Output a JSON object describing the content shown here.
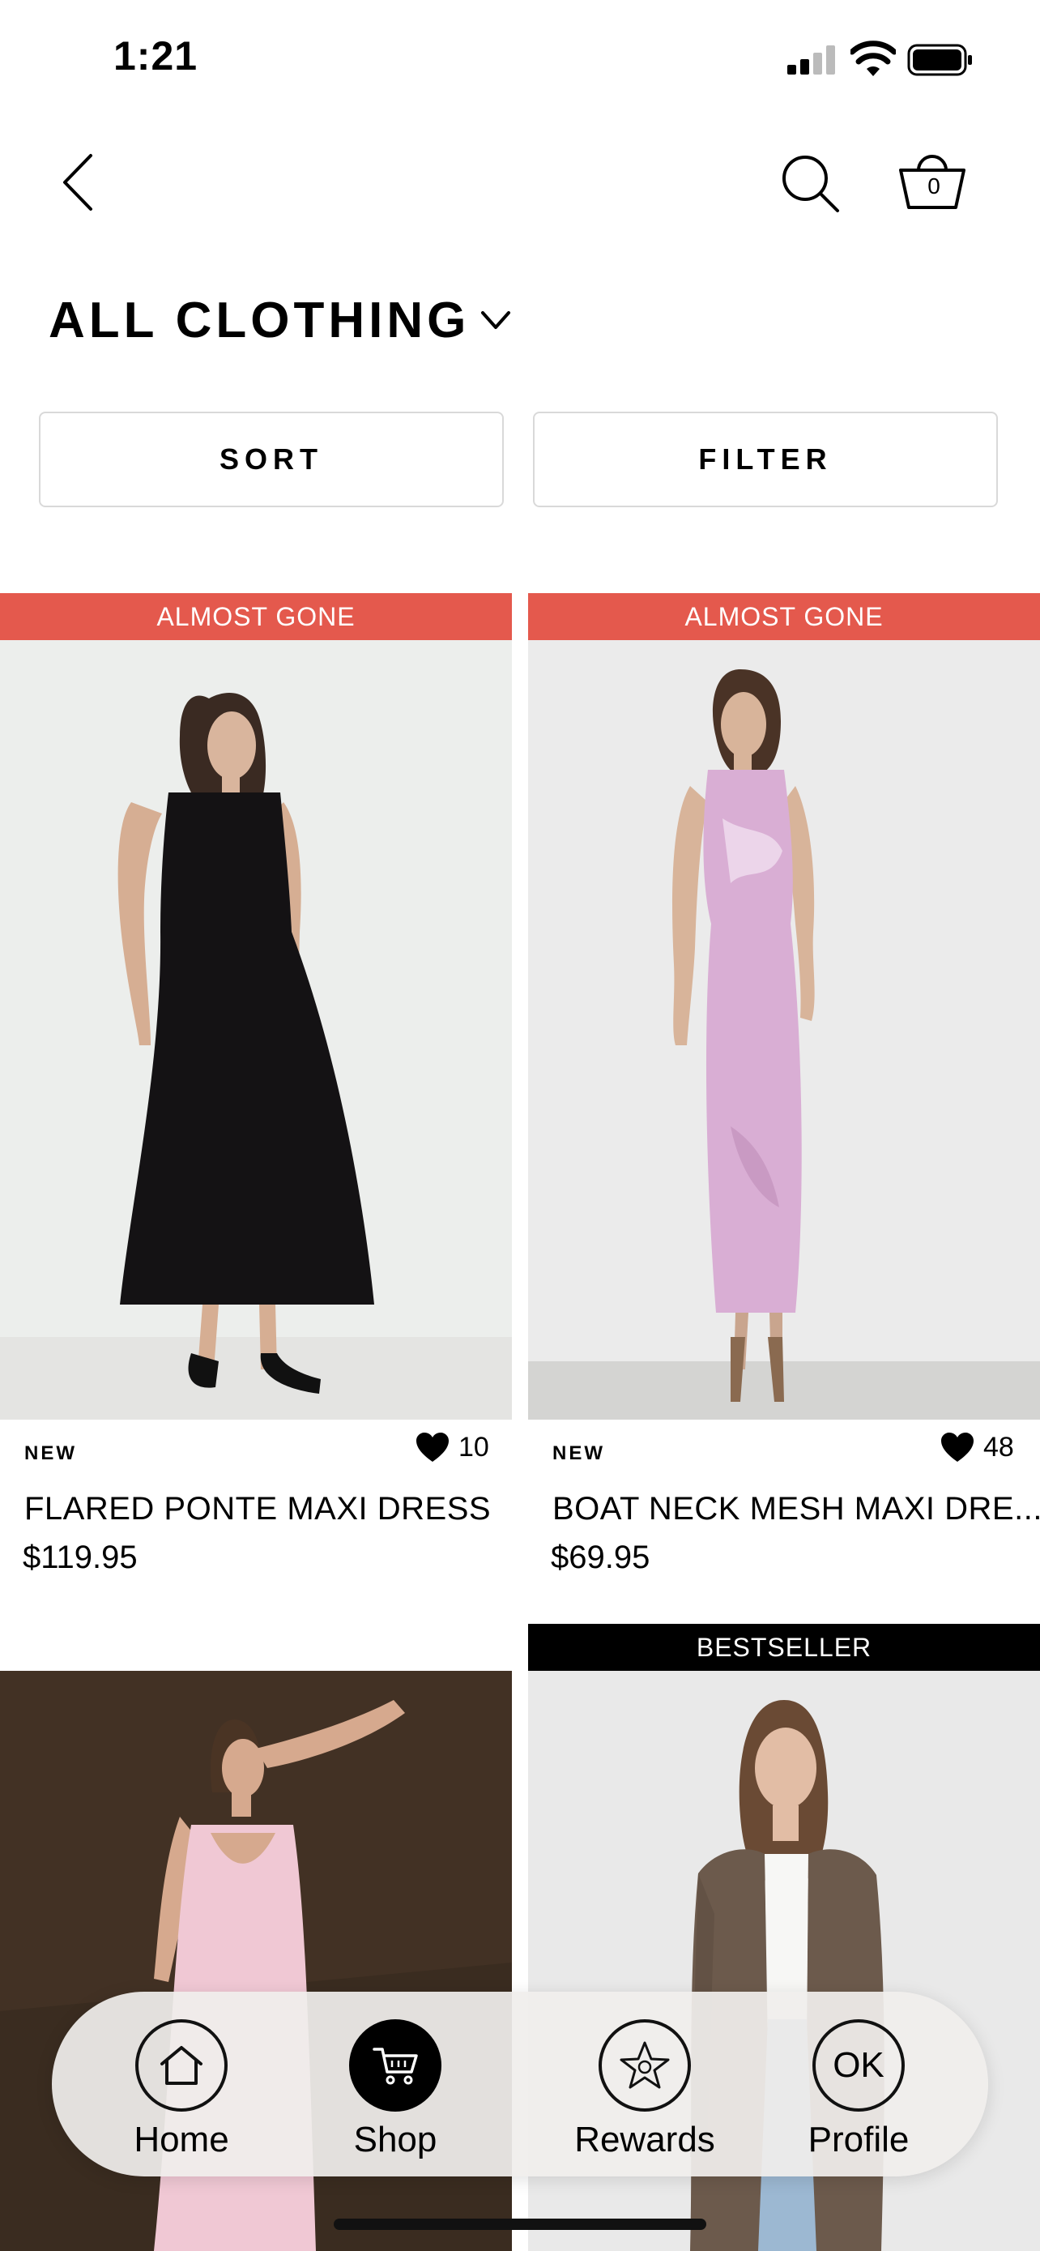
{
  "status_bar": {
    "time": "1:21"
  },
  "header": {
    "cart_count": "0"
  },
  "page": {
    "title": "ALL CLOTHING"
  },
  "controls": {
    "sort_label": "SORT",
    "filter_label": "FILTER"
  },
  "products": [
    {
      "badge": "ALMOST GONE",
      "tag": "NEW",
      "likes": "10",
      "name": "FLARED PONTE MAXI DRESS",
      "price": "$119.95"
    },
    {
      "badge": "ALMOST GONE",
      "tag": "NEW",
      "likes": "48",
      "name": "BOAT NECK MESH MAXI DRE...",
      "price": "$69.95"
    },
    {
      "badge": "BESTSELLER"
    }
  ],
  "nav": {
    "items": [
      {
        "label": "Home",
        "icon": "home-icon"
      },
      {
        "label": "Shop",
        "icon": "cart-icon",
        "active": true
      },
      {
        "label": "Rewards",
        "icon": "star-icon"
      },
      {
        "label": "Profile",
        "initials": "OK"
      }
    ]
  },
  "colors": {
    "badge_red": "#e4594d",
    "badge_black": "#000000",
    "accent": "#000000"
  }
}
